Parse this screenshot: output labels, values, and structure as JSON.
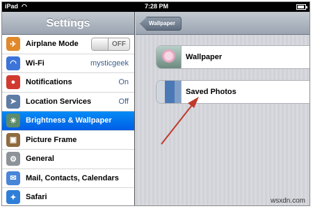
{
  "status_bar": {
    "carrier": "iPad",
    "time": "7:28 PM",
    "battery_level": 0.9
  },
  "sidebar": {
    "title": "Settings",
    "items": [
      {
        "label": "Airplane Mode",
        "icon": "airplane-icon",
        "color": "#e0892a",
        "toggle": "OFF"
      },
      {
        "label": "Wi-Fi",
        "icon": "wifi-icon",
        "color": "#3c74d8",
        "value": "mysticgeek"
      },
      {
        "label": "Notifications",
        "icon": "notifications-icon",
        "color": "#d23a2f",
        "value": "On"
      },
      {
        "label": "Location Services",
        "icon": "location-icon",
        "color": "#5e7ca4",
        "value": "Off"
      },
      {
        "label": "Brightness & Wallpaper",
        "icon": "brightness-icon",
        "color": "#5b8b6c",
        "selected": true
      },
      {
        "label": "Picture Frame",
        "icon": "picture-frame-icon",
        "color": "#8f6b3f"
      },
      {
        "label": "General",
        "icon": "gear-icon",
        "color": "#8e9399"
      },
      {
        "label": "Mail, Contacts, Calendars",
        "icon": "mail-icon",
        "color": "#4a86d8"
      },
      {
        "label": "Safari",
        "icon": "safari-icon",
        "color": "#2f7fd8"
      }
    ]
  },
  "detail": {
    "back_label": "Wallpaper",
    "rows": [
      {
        "label": "Wallpaper"
      },
      {
        "label": "Saved Photos"
      }
    ]
  },
  "watermark": "wsxdn.com",
  "colors": {
    "selected_row": "#0a6ef0",
    "annotation_arrow": "#c0392b"
  }
}
